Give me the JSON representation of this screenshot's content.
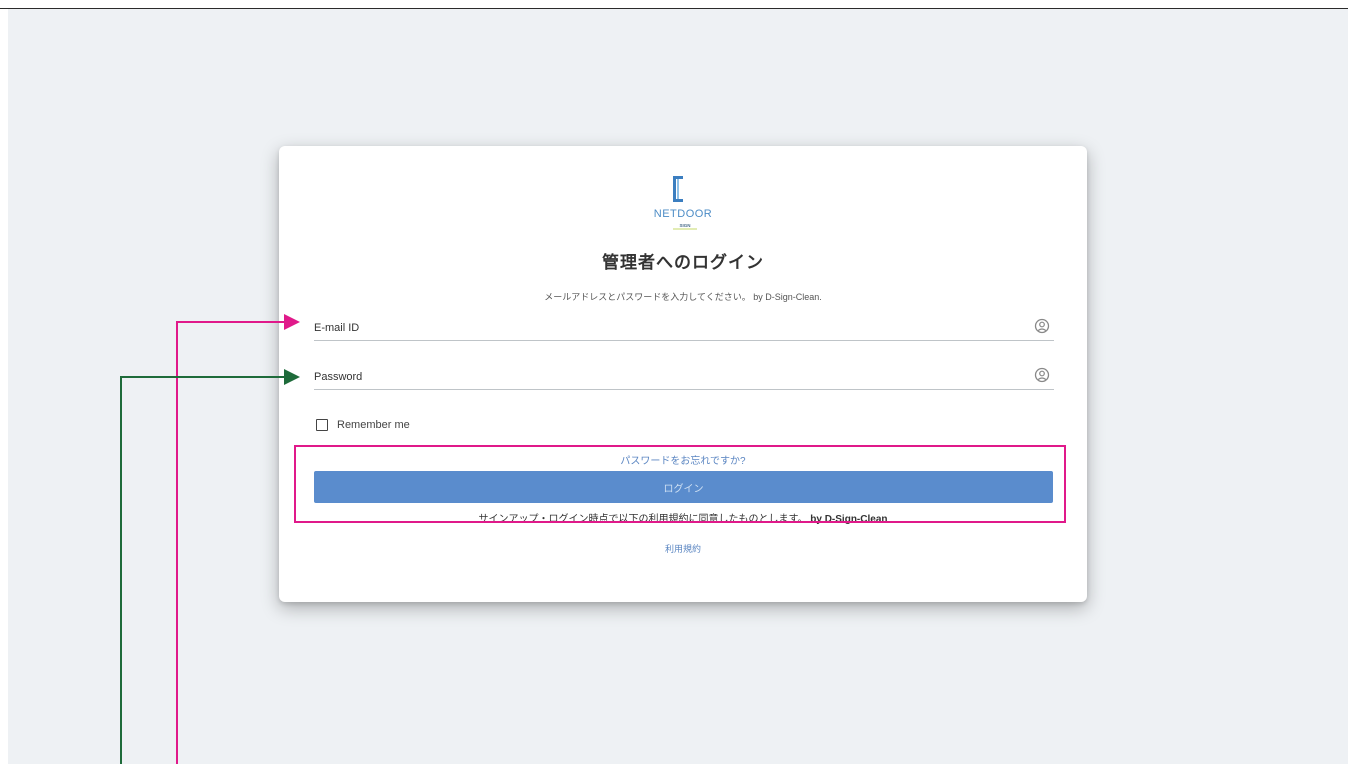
{
  "logo": {
    "text": "NETDOOR",
    "sub_text": "SIGN"
  },
  "login": {
    "title": "管理者へのログイン",
    "subtitle": "メールアドレスとパスワードを入力してください。 by D-Sign-Clean.",
    "email_placeholder": "E-mail ID",
    "password_placeholder": "Password",
    "remember_label": "Remember me",
    "forgot_link": "パスワードをお忘れですか?",
    "login_button": "ログイン",
    "terms_text": "サインアップ・ログイン時点で以下の利用規約に同意したものとします。",
    "terms_brand": "by D-Sign-Clean",
    "terms_link": "利用規約"
  },
  "colors": {
    "page_bg": "#eef1f4",
    "button": "#5a8ccd",
    "link": "#5b86c2",
    "annotation_magenta": "#e0198a",
    "annotation_green": "#1e6b3a"
  },
  "icons": {
    "email_field_icon": "person-circle-icon",
    "password_field_icon": "person-circle-icon"
  }
}
